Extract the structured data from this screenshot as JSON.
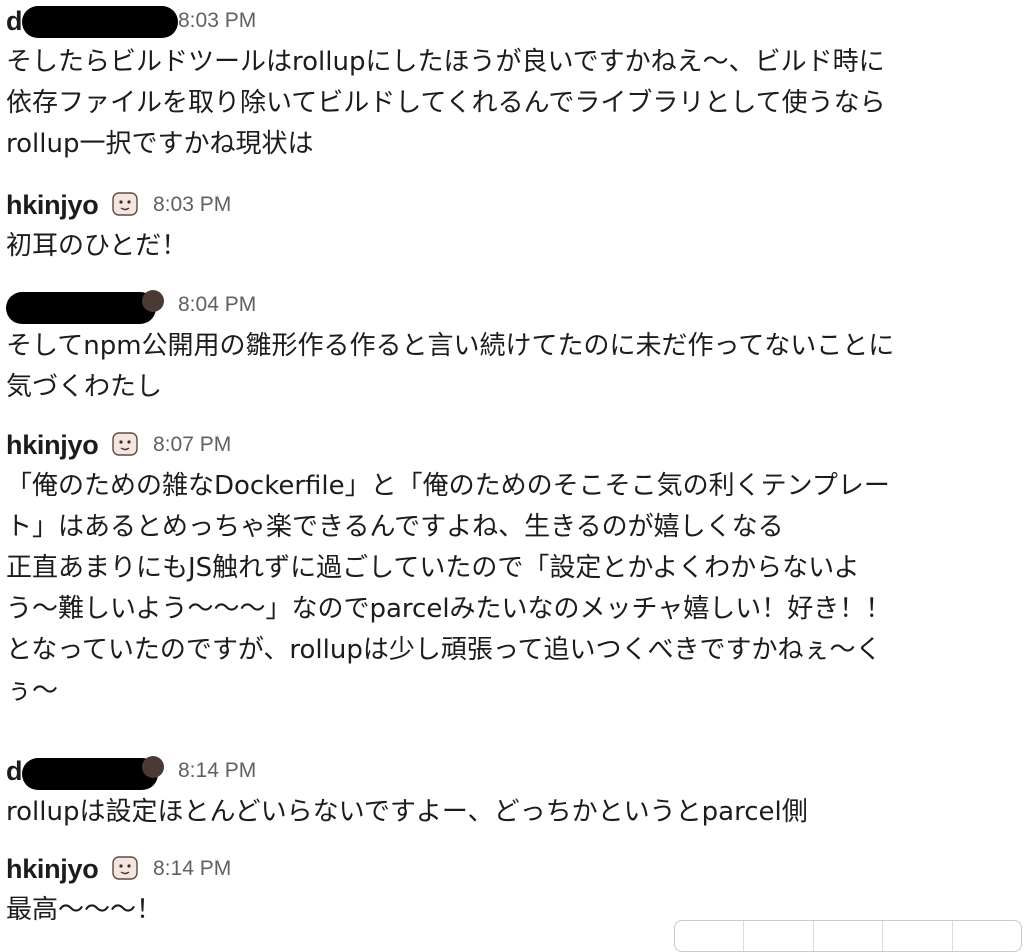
{
  "messages": [
    {
      "author": "d",
      "time": "8:03 PM",
      "lines": [
        "そしたらビルドツールはrollupにしたほうが良いですかねえ〜、ビルド時に",
        "依存ファイルを取り除いてビルドしてくれるんでライブラリとして使うなら",
        "rollup一択ですかね現状は"
      ]
    },
    {
      "author": "hkinjyo",
      "time": "8:03 PM",
      "lines": [
        "初耳のひとだ！"
      ]
    },
    {
      "author": "",
      "time": "8:04 PM",
      "lines": [
        "そしてnpm公開用の雛形作る作ると言い続けてたのに未だ作ってないことに",
        "気づくわたし"
      ]
    },
    {
      "author": "hkinjyo",
      "time": "8:07 PM",
      "lines": [
        "「俺のための雑なDockerfile」と「俺のためのそこそこ気の利くテンプレー",
        "ト」はあるとめっちゃ楽できるんですよね、生きるのが嬉しくなる",
        "正直あまりにもJS触れずに過ごしていたので「設定とかよくわからないよ",
        "う〜難しいよう〜〜〜」なのでparcelみたいなのメッチャ嬉しい！好き！！",
        "となっていたのですが、rollupは少し頑張って追いつくべきですかねぇ〜く",
        "ぅ〜"
      ]
    },
    {
      "author": "d",
      "time": "8:14 PM",
      "lines": [
        "rollupは設定ほとんどいらないですよー、どっちかというとparcel側"
      ]
    },
    {
      "author": "hkinjyo",
      "time": "8:14 PM",
      "lines": [
        "最高〜〜〜！"
      ]
    }
  ]
}
